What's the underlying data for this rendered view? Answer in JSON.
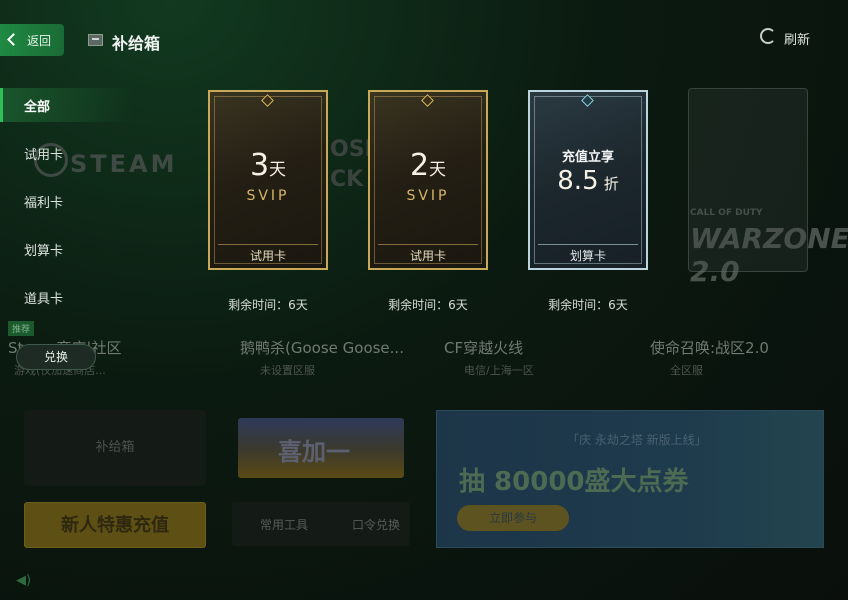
{
  "header": {
    "back_label": "返回",
    "title": "补给箱",
    "refresh_label": "刷新"
  },
  "sidebar": {
    "items": [
      {
        "label": "全部"
      },
      {
        "label": "试用卡"
      },
      {
        "label": "福利卡"
      },
      {
        "label": "划算卡"
      },
      {
        "label": "道具卡"
      }
    ],
    "redeem_label": "兑换"
  },
  "cards": [
    {
      "value": "3",
      "unit": "天",
      "tier": "SVIP",
      "type": "试用卡",
      "remaining": "剩余时间：6天"
    },
    {
      "value": "2",
      "unit": "天",
      "tier": "SVIP",
      "type": "试用卡",
      "remaining": "剩余时间：6天"
    },
    {
      "headline": "充值立享",
      "value": "8.5",
      "unit": "折",
      "type": "划算卡",
      "remaining": "剩余时间：6天"
    }
  ],
  "background": {
    "steam_logo": "STEAM",
    "tiles": [
      {
        "tag": "推荐",
        "name": "Steam商店|社区",
        "sub": "游戏(仅加速商店..."
      },
      {
        "name": "鹅鸭杀(Goose Goose...",
        "sub": "未设置区服"
      },
      {
        "name": "CF穿越火线",
        "sub": "电信/上海一区"
      },
      {
        "name": "使命召唤:战区2.0",
        "sub": "全区服"
      }
    ],
    "goose_art": "OSE\nCK",
    "warzone_small": "CALL OF DUTY",
    "warzone_big": "WARZONE 2.0",
    "supply_box": "补给箱",
    "xijia": "喜加一",
    "tools": [
      "常用工具",
      "口令兑换"
    ],
    "newbie": "新人特惠充值",
    "promo": {
      "top": "「庆 永劫之塔 新版上线」",
      "title": "抽 80000盛大点券",
      "button": "立即参与"
    }
  }
}
